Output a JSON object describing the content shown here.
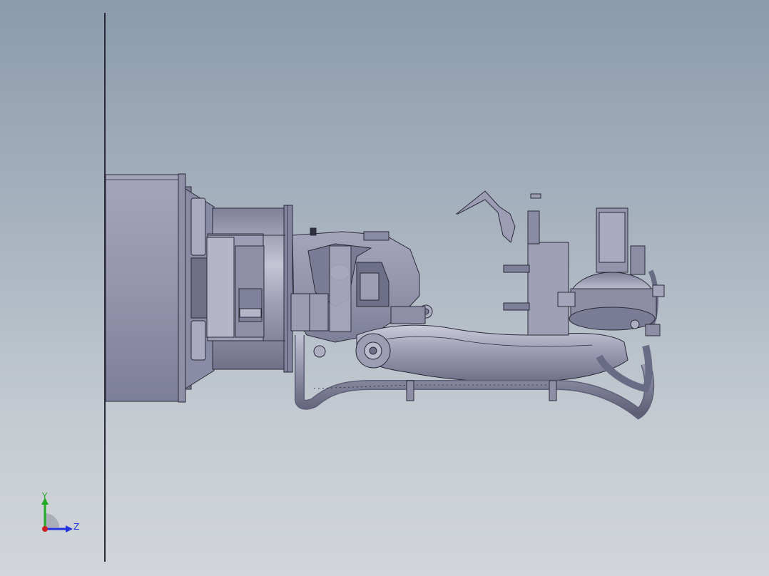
{
  "triad": {
    "y_label": "Y",
    "z_label": "Z",
    "y_color": "#22aa22",
    "z_color": "#2233dd",
    "x_color": "#cc2222"
  },
  "model": {
    "body_color": "#8f90a8",
    "light_color": "#bcbdcf",
    "dark_color": "#6c6d85",
    "edge_color": "#2a2a38"
  }
}
